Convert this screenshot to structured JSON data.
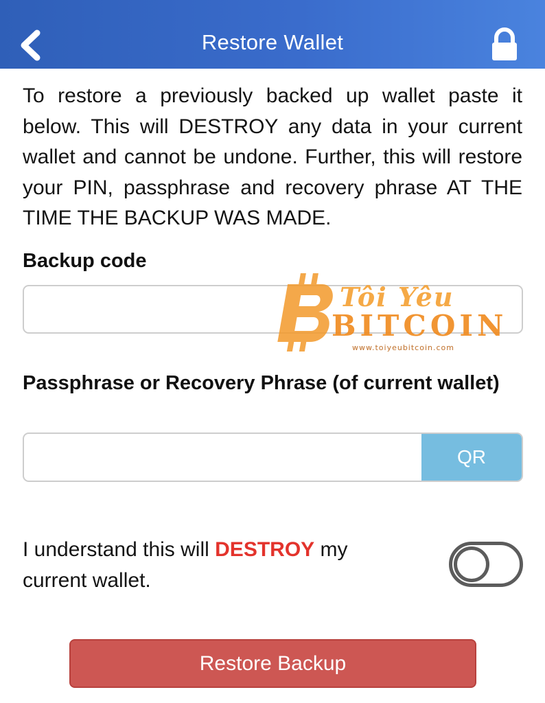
{
  "header": {
    "title": "Restore Wallet",
    "back_icon": "chevron-left-icon",
    "lock_icon": "lock-icon"
  },
  "intro_text": "To restore a previously backed up wallet paste it below. This will DESTROY any data in your current wallet and cannot be undone. Further, this will restore your PIN, passphrase and recovery phrase AT THE TIME THE BACKUP WAS MADE.",
  "backup": {
    "label": "Backup code",
    "value": ""
  },
  "passphrase": {
    "label": "Passphrase or Recovery Phrase (of current wallet)",
    "value": "",
    "qr_label": "QR"
  },
  "confirm": {
    "text_before": "I understand this will ",
    "highlight": "DESTROY",
    "text_after": " my current wallet.",
    "toggle_on": false
  },
  "restore_button": "Restore Backup",
  "watermark": {
    "coin_text": "BITCOIN",
    "brand_top": "Tôi Yêu",
    "brand_bottom": "BITCOIN",
    "url": "www.toiyeubitcoin.com"
  },
  "colors": {
    "header": "#3a6ccc",
    "qr_button": "#76bde0",
    "destroy_text": "#e3332c",
    "restore_button": "#cd5753"
  }
}
